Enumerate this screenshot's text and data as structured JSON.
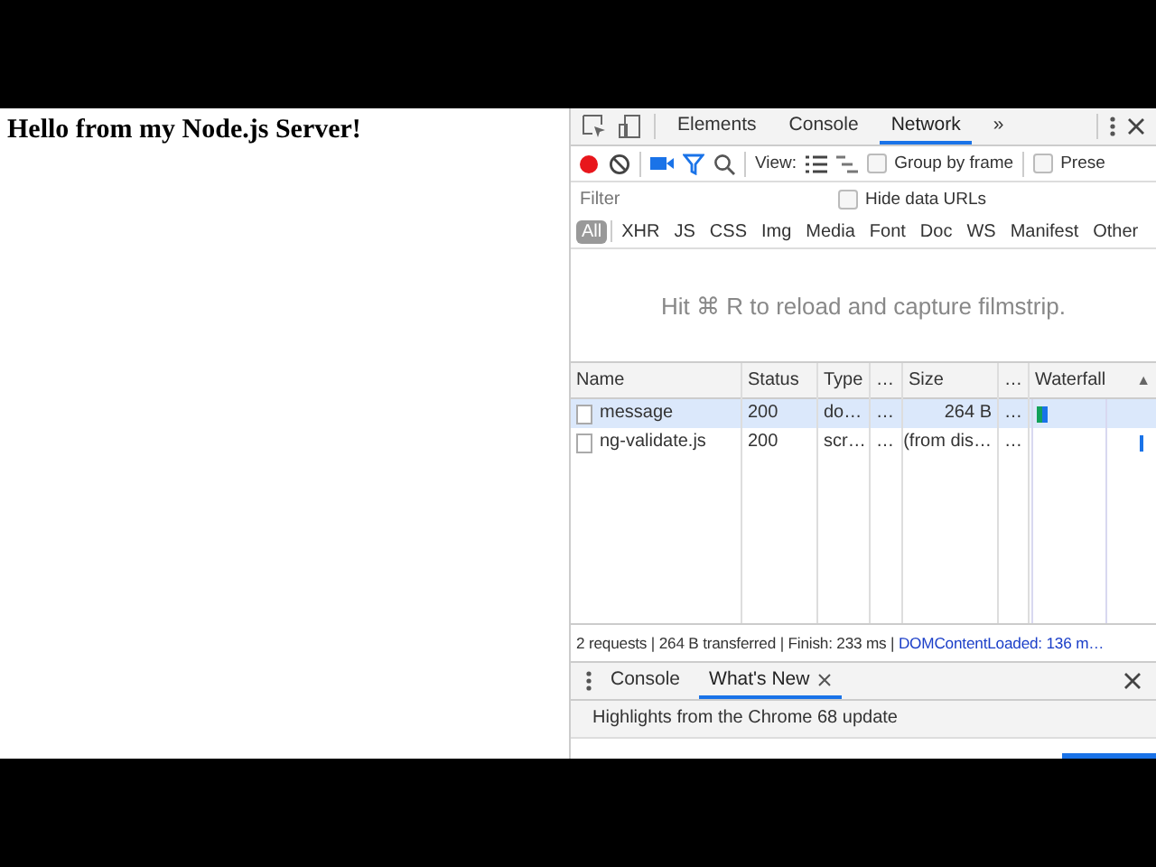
{
  "page": {
    "heading": "Hello from my Node.js Server!"
  },
  "devtools": {
    "tabs": [
      {
        "label": "Elements",
        "selected": false
      },
      {
        "label": "Console",
        "selected": false
      },
      {
        "label": "Network",
        "selected": true
      }
    ],
    "more_tabs": "»",
    "toolbar": {
      "recording": true,
      "view_label": "View:",
      "options": [
        {
          "label": "Group by frame",
          "checked": false
        },
        {
          "label": "Prese",
          "checked": false
        }
      ]
    },
    "filter": {
      "placeholder": "Filter",
      "hide_data_urls": {
        "label": "Hide data URLs",
        "checked": false
      }
    },
    "types": [
      {
        "label": "All",
        "selected": true
      },
      {
        "label": "XHR",
        "selected": false
      },
      {
        "label": "JS",
        "selected": false
      },
      {
        "label": "CSS",
        "selected": false
      },
      {
        "label": "Img",
        "selected": false
      },
      {
        "label": "Media",
        "selected": false
      },
      {
        "label": "Font",
        "selected": false
      },
      {
        "label": "Doc",
        "selected": false
      },
      {
        "label": "WS",
        "selected": false
      },
      {
        "label": "Manifest",
        "selected": false
      },
      {
        "label": "Other",
        "selected": false
      }
    ],
    "filmstrip_hint": "Hit ⌘ R to reload and capture filmstrip.",
    "table": {
      "columns": [
        "Name",
        "Status",
        "Type",
        "…",
        "Size",
        "…",
        "Waterfall"
      ],
      "sort_indicator": "▲",
      "rows": [
        {
          "cells": [
            "message",
            "200",
            "do…",
            "…",
            "264 B",
            "…"
          ],
          "selected": true,
          "kind": "bar"
        },
        {
          "cells": [
            "ng-validate.js",
            "200",
            "scr…",
            "…",
            "(from dis…",
            "…"
          ],
          "selected": false,
          "kind": "tick"
        }
      ]
    },
    "status_bar": {
      "summary": "2 requests | 264 B transferred | Finish: 233 ms |",
      "link": "DOMContentLoaded: 136 m…"
    },
    "drawer": {
      "tabs": [
        {
          "label": "Console",
          "selected": false,
          "closable": false
        },
        {
          "label": "What's New",
          "selected": true,
          "closable": true
        }
      ],
      "highlights": "Highlights from the Chrome 68 update"
    }
  }
}
